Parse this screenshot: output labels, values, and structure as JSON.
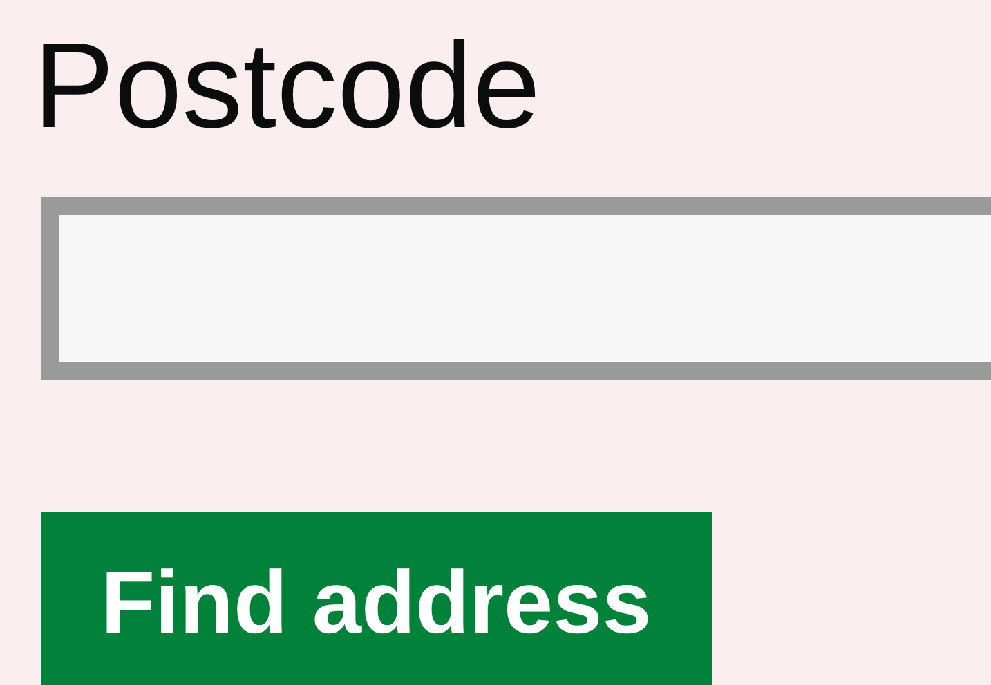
{
  "postcode_field": {
    "label": "Postcode"
  },
  "button": {
    "label": "Find address"
  }
}
